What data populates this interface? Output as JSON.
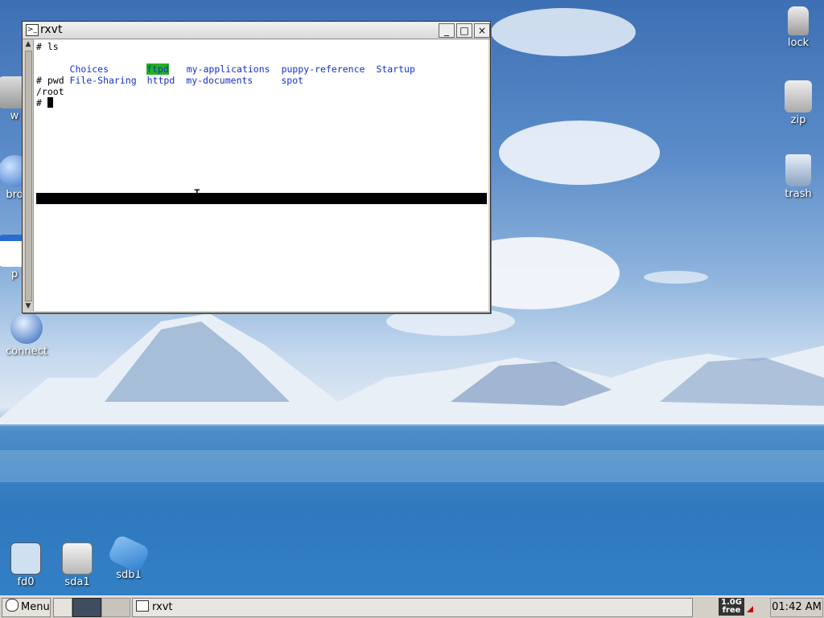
{
  "window": {
    "title": "rxvt",
    "buttons": {
      "minimize": "_",
      "maximize": "□",
      "close": "×"
    }
  },
  "terminal": {
    "line1": "# ls",
    "ls_row1": [
      "Choices",
      "ftpd",
      "my-applications",
      "puppy-reference",
      "Startup"
    ],
    "ls_row2": [
      "File-Sharing",
      "httpd",
      "my-documents",
      "spot"
    ],
    "line4": "# pwd",
    "line5": "/root",
    "prompt": "# "
  },
  "desktop_right": [
    {
      "label": "lock",
      "icon": "lock-icon"
    },
    {
      "label": "zip",
      "icon": "zip-icon"
    },
    {
      "label": "trash",
      "icon": "trash-icon"
    }
  ],
  "desktop_left": [
    {
      "label": "w",
      "icon": "editor-icon"
    },
    {
      "label": "bro",
      "icon": "browser-icon"
    },
    {
      "label": "p",
      "icon": "calendar-icon"
    },
    {
      "label": "connect",
      "icon": "connect-icon"
    }
  ],
  "drives": [
    {
      "label": "fd0",
      "icon": "floppy-icon"
    },
    {
      "label": "sda1",
      "icon": "harddisk-icon"
    },
    {
      "label": "sdb1",
      "icon": "usb-icon"
    }
  ],
  "taskbar": {
    "menu_label": "Menu",
    "task_label": "rxvt",
    "free_mem_top": "1.0G",
    "free_mem_bottom": "free",
    "clock": "01:42 AM"
  }
}
